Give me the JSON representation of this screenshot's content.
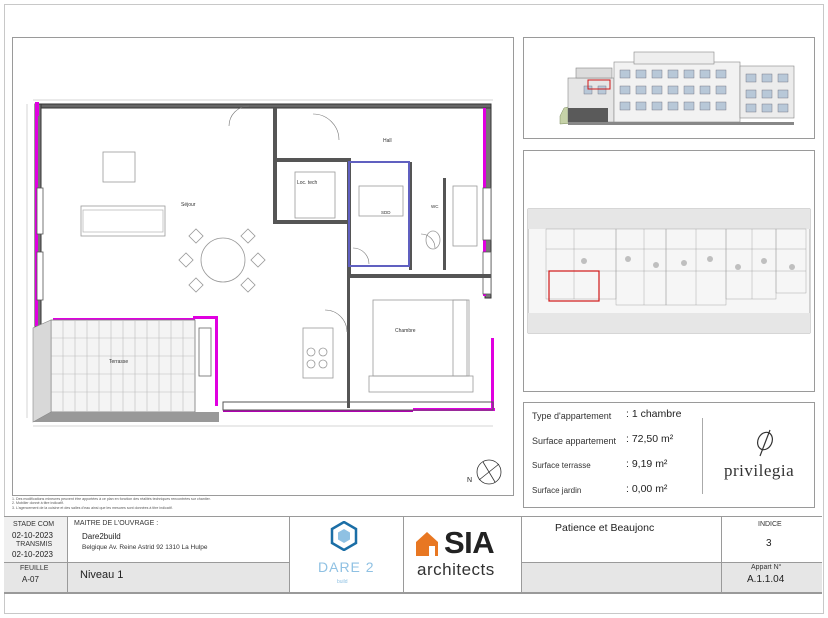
{
  "floor_plan": {
    "rooms": {
      "sejour": "Séjour",
      "hall": "Hall",
      "loc_tech": "Loc. tech",
      "sdd": "SDD",
      "wc": "WC",
      "chambre": "Chambre",
      "terrasse": "Terrasse"
    },
    "north_label": "N"
  },
  "notes": [
    "1. Des modifications mineures peuvent être apportées à ce plan en fonction des réalités techniques rencontrées sur chantier.",
    "2. Mobilier donné à titre indicatif.",
    "3. L'agencement de la cuisine et des salles d'eau ainsi que les mesures sont données à titre indicatif."
  ],
  "apartment_info": {
    "type_label": "Type d'appartement",
    "type_value": ": 1 chambre",
    "surface_label": "Surface appartement",
    "surface_value": ": 72,50 m²",
    "terrace_label": "Surface terrasse",
    "terrace_value": ": 9,19 m²",
    "garden_label": "Surface jardin",
    "garden_value": ": 0,00 m²"
  },
  "brand": {
    "name": "privilegia"
  },
  "title_block": {
    "stade_label": "STADE COM",
    "stade_date": "02-10-2023",
    "transmis_label": "TRANSMIS",
    "transmis_date": "02-10-2023",
    "feuille_label": "FEUILLE",
    "feuille_value": "A-07",
    "maitre_label": "MAITRE DE L'OUVRAGE :",
    "maitre_name": "Dare2build",
    "maitre_address": "Belgique Av. Reine Astrid 92   1310 La Hulpe",
    "niveau": "Niveau 1",
    "dare_logo_text": "DARE 2",
    "dare_logo_sub": "build",
    "sia_logo": "SIA",
    "sia_sub": "architects",
    "project_name": "Patience et Beaujonc",
    "indice_label": "INDICE",
    "indice_value": "3",
    "appart_label": "Appart N°",
    "appart_value": "A.1.1.04"
  },
  "colors": {
    "accent_magenta": "#e000e0",
    "highlight_red": "#d01818",
    "plan_blue": "#6060c0",
    "sia_orange": "#e87722",
    "dare_blue": "#1b6ea6"
  }
}
